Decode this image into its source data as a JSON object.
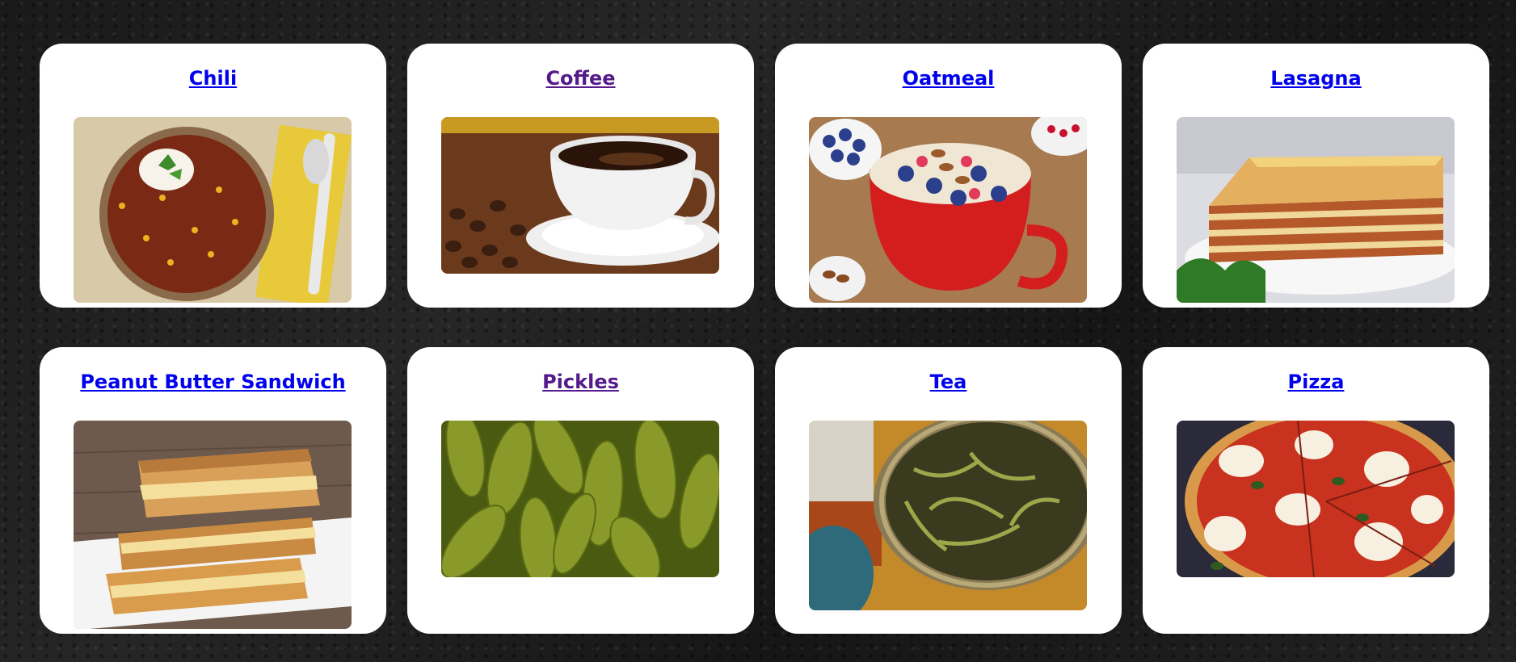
{
  "cards": [
    {
      "title": "Chili",
      "image": "chili-photo",
      "visited": false
    },
    {
      "title": "Coffee",
      "image": "coffee-photo",
      "visited": true
    },
    {
      "title": "Oatmeal",
      "image": "oatmeal-photo",
      "visited": false
    },
    {
      "title": "Lasagna",
      "image": "lasagna-photo",
      "visited": false
    },
    {
      "title": "Peanut Butter Sandwich",
      "image": "peanut-butter-sandwich-photo",
      "visited": false
    },
    {
      "title": "Pickles",
      "image": "pickles-photo",
      "visited": true
    },
    {
      "title": "Tea",
      "image": "tea-photo",
      "visited": false
    },
    {
      "title": "Pizza",
      "image": "pizza-photo",
      "visited": false
    }
  ],
  "colors": {
    "link": "#0000ee",
    "visited_link": "#551a8b",
    "card_background": "#ffffff",
    "page_background": "#1c1c1c"
  }
}
